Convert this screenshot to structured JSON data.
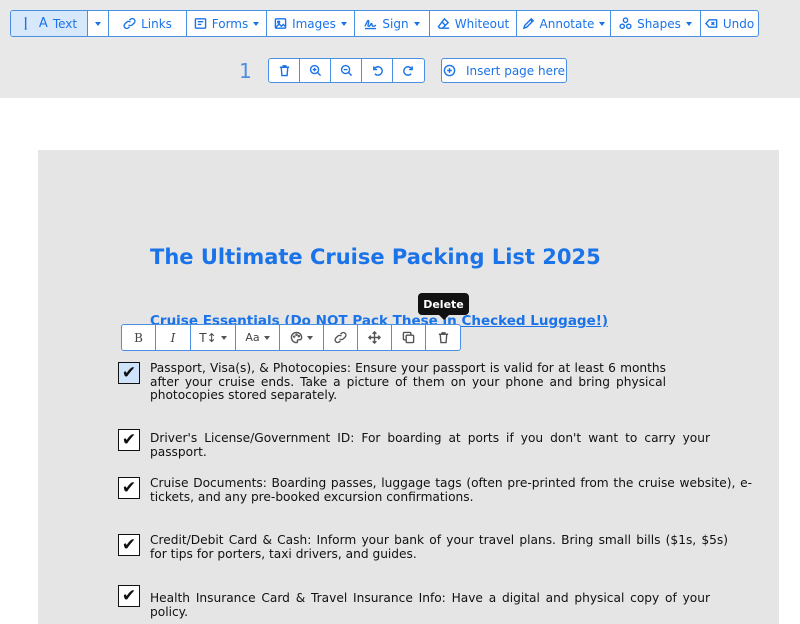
{
  "toolbar": {
    "items": [
      {
        "id": "text",
        "label": "Text",
        "icon": "text-cursor-icon",
        "dropdown": false,
        "active": true
      },
      {
        "id": "text-more",
        "label": "",
        "icon": "caret-down-icon",
        "dropdown": true,
        "active": true
      },
      {
        "id": "links",
        "label": "Links",
        "icon": "link-icon",
        "dropdown": false
      },
      {
        "id": "forms",
        "label": "Forms",
        "icon": "form-icon",
        "dropdown": true
      },
      {
        "id": "images",
        "label": "Images",
        "icon": "image-icon",
        "dropdown": true
      },
      {
        "id": "sign",
        "label": "Sign",
        "icon": "signature-icon",
        "dropdown": true
      },
      {
        "id": "whiteout",
        "label": "Whiteout",
        "icon": "eraser-icon",
        "dropdown": false
      },
      {
        "id": "annotate",
        "label": "Annotate",
        "icon": "pencil-icon",
        "dropdown": true
      },
      {
        "id": "shapes",
        "label": "Shapes",
        "icon": "shapes-icon",
        "dropdown": true
      },
      {
        "id": "undo",
        "label": "Undo",
        "icon": "undo-icon",
        "dropdown": false
      }
    ]
  },
  "page_controls": {
    "page_number": "1",
    "buttons": [
      "delete-page",
      "zoom-in",
      "zoom-out",
      "rotate-left",
      "rotate-right"
    ],
    "insert_label": "Insert page here"
  },
  "document": {
    "title": "The Ultimate Cruise Packing List 2025",
    "subtitle": "Cruise Essentials (Do NOT Pack These in Checked Luggage!)",
    "check_mark": "✔",
    "items": [
      {
        "text": "Passport, Visa(s), & Photocopies: Ensure your passport is valid for at least 6 months after your cruise ends. Take a picture of them on your phone and bring physical photocopies stored separately.",
        "selected": true
      },
      {
        "text": "Driver's License/Government ID: For boarding at ports if you don't want to carry your passport.",
        "selected": false
      },
      {
        "text": "Cruise Documents: Boarding passes, luggage tags (often pre-printed from the cruise website), e-tickets, and any pre-booked excursion confirmations.",
        "selected": false
      },
      {
        "text": "Credit/Debit Card & Cash: Inform your bank of your travel plans. Bring small bills ($1s, $5s) for tips for porters, taxi drivers, and guides.",
        "selected": false
      },
      {
        "text": "Health Insurance Card & Travel Insurance Info: Have a digital and physical copy of your policy.",
        "selected": false
      }
    ]
  },
  "format_toolbar": {
    "buttons": [
      {
        "id": "bold",
        "label": "B",
        "dropdown": false
      },
      {
        "id": "italic",
        "label": "I",
        "dropdown": false
      },
      {
        "id": "text-size",
        "label": "T↕",
        "dropdown": true
      },
      {
        "id": "font",
        "label": "Aa",
        "dropdown": true
      },
      {
        "id": "color",
        "label": "",
        "icon": "palette-icon",
        "dropdown": true
      },
      {
        "id": "link",
        "label": "",
        "icon": "link-icon",
        "dropdown": false
      },
      {
        "id": "move",
        "label": "",
        "icon": "move-icon",
        "dropdown": false
      },
      {
        "id": "duplicate",
        "label": "",
        "icon": "copy-icon",
        "dropdown": false
      },
      {
        "id": "delete",
        "label": "",
        "icon": "trash-icon",
        "dropdown": false
      }
    ]
  },
  "tooltip": {
    "label": "Delete"
  },
  "colors": {
    "accent": "#1a73e8",
    "border": "#4a90e2",
    "page": "#e5e5e5",
    "topbar": "#e8e8e8"
  }
}
